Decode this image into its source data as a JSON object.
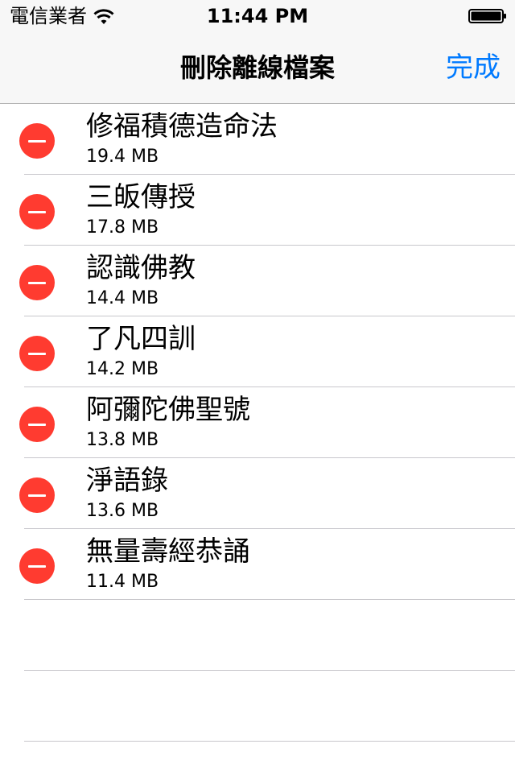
{
  "status_bar": {
    "carrier": "電信業者",
    "time": "11:44 PM"
  },
  "nav": {
    "title": "刪除離線檔案",
    "done_label": "完成",
    "accent_color": "#007aff"
  },
  "items": [
    {
      "title": "修福積德造命法",
      "size": "19.4 MB"
    },
    {
      "title": "三皈傳授",
      "size": "17.8 MB"
    },
    {
      "title": "認識佛教",
      "size": "14.4 MB"
    },
    {
      "title": "了凡四訓",
      "size": "14.2 MB"
    },
    {
      "title": "阿彌陀佛聖號",
      "size": "13.8 MB"
    },
    {
      "title": "淨語錄",
      "size": "13.6 MB"
    },
    {
      "title": "無量壽經恭誦",
      "size": "11.4 MB"
    }
  ],
  "delete_color": "#ff3b30",
  "icons": {
    "delete": "minus-circle-icon",
    "wifi": "wifi-icon",
    "battery": "battery-icon"
  }
}
